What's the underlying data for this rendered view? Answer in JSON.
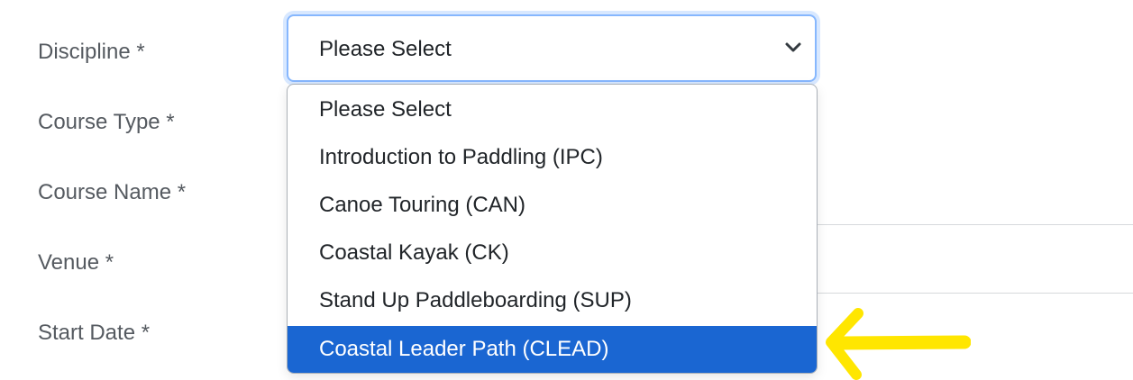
{
  "form": {
    "labels": {
      "discipline": "Discipline *",
      "course_type": "Course Type *",
      "course_name": "Course Name *",
      "venue": "Venue *",
      "start_date": "Start Date *"
    }
  },
  "discipline_select": {
    "value": "Please Select",
    "icon": "chevron-down-icon",
    "focus_color": "#86b7fe"
  },
  "dropdown": {
    "options": [
      "Please Select",
      "Introduction to Paddling (IPC)",
      "Canoe Touring (CAN)",
      "Coastal Kayak (CK)",
      "Stand Up Paddleboarding (SUP)",
      "Coastal Leader Path (CLEAD)"
    ],
    "highlighted_option": "Coastal Leader Path (CLEAD)",
    "highlight_color": "#1a66d2"
  },
  "annotation": {
    "icon": "arrow-left-icon",
    "color": "#ffe600"
  }
}
